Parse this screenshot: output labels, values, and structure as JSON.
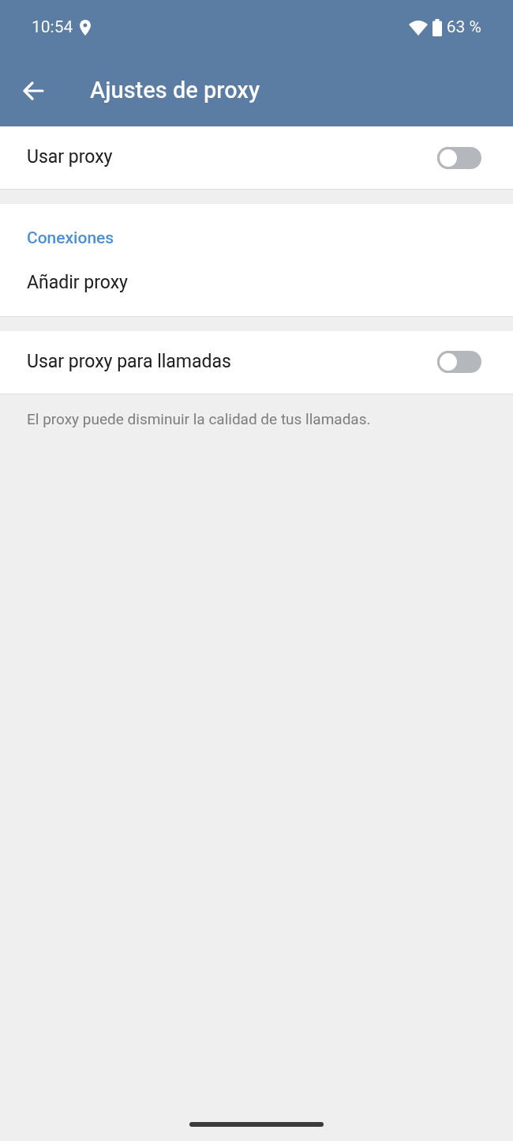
{
  "status_bar": {
    "time": "10:54",
    "battery": "63 %"
  },
  "toolbar": {
    "title": "Ajustes de proxy"
  },
  "use_proxy": {
    "label": "Usar proxy",
    "on": false
  },
  "connections": {
    "header": "Conexiones",
    "items": [
      {
        "label": "Añadir proxy"
      }
    ]
  },
  "calls_proxy": {
    "label": "Usar proxy para llamadas",
    "on": false
  },
  "note": "El proxy puede disminuir la calidad de tus llamadas."
}
